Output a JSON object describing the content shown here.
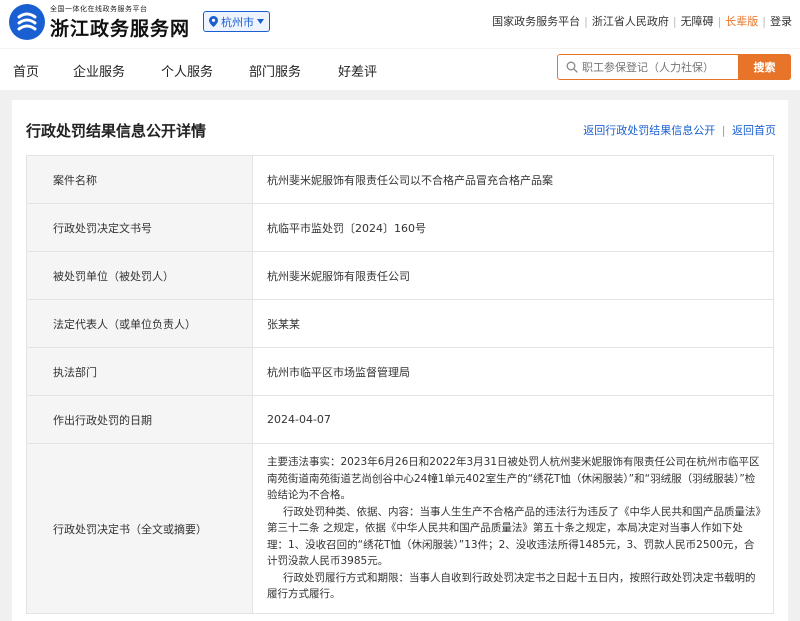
{
  "header": {
    "logo_sub": "全国一体化在线政务服务平台",
    "logo_main": "浙江政务服务网",
    "city": "杭州市",
    "top_links": [
      "国家政务服务平台",
      "浙江省人民政府",
      "无障碍",
      "长辈版",
      "登录"
    ]
  },
  "nav": {
    "items": [
      "首页",
      "企业服务",
      "个人服务",
      "部门服务",
      "好差评"
    ]
  },
  "search": {
    "placeholder": "职工参保登记（人力社保）",
    "button": "搜索"
  },
  "page": {
    "title": "行政处罚结果信息公开详情",
    "link_back_list": "返回行政处罚结果信息公开",
    "link_home": "返回首页"
  },
  "details": {
    "rows": [
      {
        "label": "案件名称",
        "value": "杭州斐米妮服饰有限责任公司以不合格产品冒充合格产品案"
      },
      {
        "label": "行政处罚决定文书号",
        "value": "杭临平市监处罚〔2024〕160号"
      },
      {
        "label": "被处罚单位（被处罚人）",
        "value": "杭州斐米妮服饰有限责任公司"
      },
      {
        "label": "法定代表人（或单位负责人）",
        "value": "张某某"
      },
      {
        "label": "执法部门",
        "value": "杭州市临平区市场监督管理局"
      },
      {
        "label": "作出行政处罚的日期",
        "value": "2024-04-07"
      }
    ],
    "decision_label": "行政处罚决定书（全文或摘要）",
    "decision_paragraphs": [
      "主要违法事实：2023年6月26日和2022年3月31日被处罚人杭州斐米妮服饰有限责任公司在杭州市临平区南苑街道南苑街道艺尚创谷中心24幢1单元402室生产的“绣花T恤（休闲服装）”和“羽绒服（羽绒服装）”检验结论为不合格。",
      "行政处罚种类、依据、内容：当事人生生产不合格产品的违法行为违反了《中华人民共和国产品质量法》第三十二条 之规定，依据《中华人民共和国产品质量法》第五十条之规定，本局决定对当事人作如下处理：1、没收召回的“绣花T恤（休闲服装）”13件；2、没收违法所得1485元，3、罚款人民币2500元，合计罚没款人民币3985元。",
      "行政处罚履行方式和期限：当事人自收到行政处罚决定书之日起十五日内，按照行政处罚决定书载明的履行方式履行。"
    ]
  },
  "colors": {
    "brand_blue": "#1a5fd1",
    "accent_orange": "#e8742a"
  }
}
